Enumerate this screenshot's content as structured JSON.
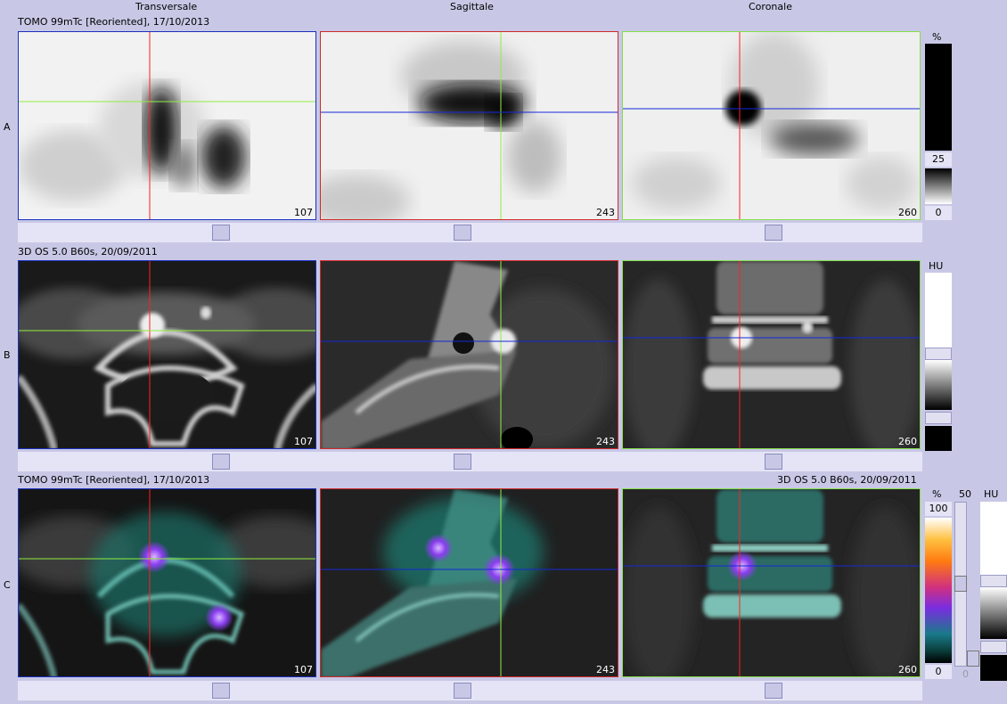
{
  "headers": {
    "transversal": "Transversale",
    "sagittal": "Sagittale",
    "coronal": "Coronale"
  },
  "rows": {
    "a": {
      "label": "A",
      "title": "TOMO 99mTc [Reoriented], 17/10/2013"
    },
    "b": {
      "label": "B",
      "title": "3D  OS  5.0  B60s, 20/09/2011"
    },
    "c": {
      "label": "C",
      "title_left": "TOMO 99mTc [Reoriented], 17/10/2013",
      "title_right": "3D  OS  5.0  B60s, 20/09/2011"
    }
  },
  "slices": {
    "transversal": "107",
    "sagittal": "243",
    "coronal": "260"
  },
  "scales": {
    "a": {
      "unit": "%",
      "max": "25",
      "min": "0"
    },
    "b": {
      "unit": "HU"
    },
    "c": {
      "pct_unit": "%",
      "pct_max": "100",
      "pct_min": "0",
      "opacity_max": "50",
      "opacity_min": "0",
      "hu_unit": "HU"
    }
  },
  "colors": {
    "background": "#c8c8e6",
    "transversal_border": "#1a2fbf",
    "sagittal_border": "#cf2a2a",
    "coronal_border": "#86de4a"
  }
}
